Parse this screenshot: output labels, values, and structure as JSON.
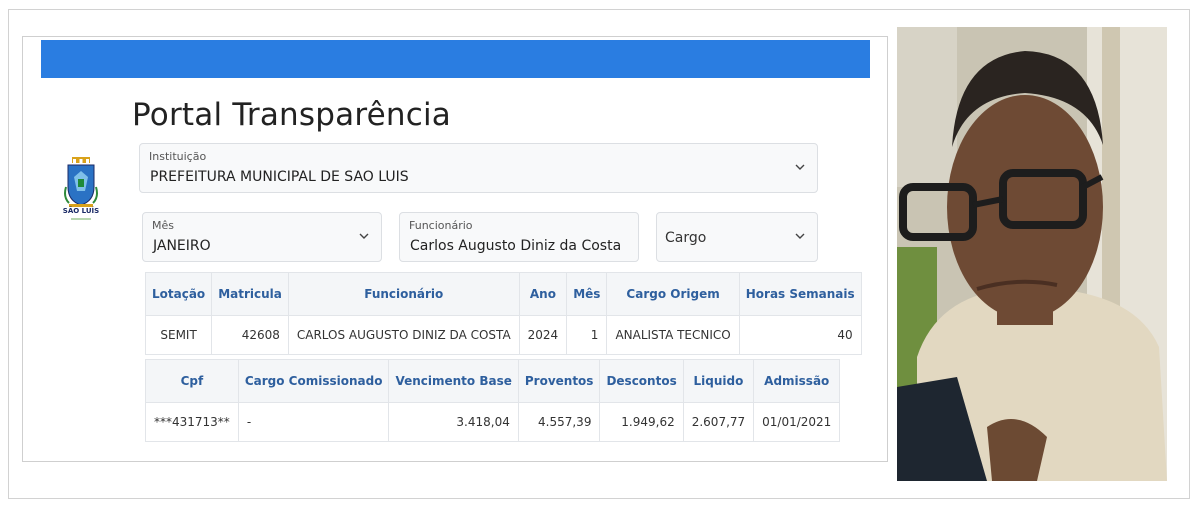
{
  "portal": {
    "title": "Portal Transparência",
    "logo_caption": "SÃO LUÍS",
    "instituicao": {
      "label": "Instituição",
      "value": "PREFEITURA MUNICIPAL DE SAO LUIS"
    },
    "mes": {
      "label": "Mês",
      "value": "JANEIRO"
    },
    "funcionario": {
      "label": "Funcionário",
      "value": "Carlos Augusto Diniz da Costa"
    },
    "cargo": {
      "placeholder": "Cargo"
    }
  },
  "table1": {
    "headers": [
      "Lotação",
      "Matricula",
      "Funcionário",
      "Ano",
      "Mês",
      "Cargo Origem",
      "Horas Semanais"
    ],
    "row": [
      "SEMIT",
      "42608",
      "CARLOS AUGUSTO DINIZ DA COSTA",
      "2024",
      "1",
      "ANALISTA TECNICO",
      "40"
    ]
  },
  "table2": {
    "headers": [
      "Cpf",
      "Cargo Comissionado",
      "Vencimento Base",
      "Proventos",
      "Descontos",
      "Liquido",
      "Admissão"
    ],
    "row": [
      "***431713**",
      "-",
      "3.418,04",
      "4.557,39",
      "1.949,62",
      "2.607,77",
      "01/01/2021"
    ]
  },
  "colors": {
    "topbar": "#2a7de1",
    "header_text": "#2e5f9e"
  }
}
